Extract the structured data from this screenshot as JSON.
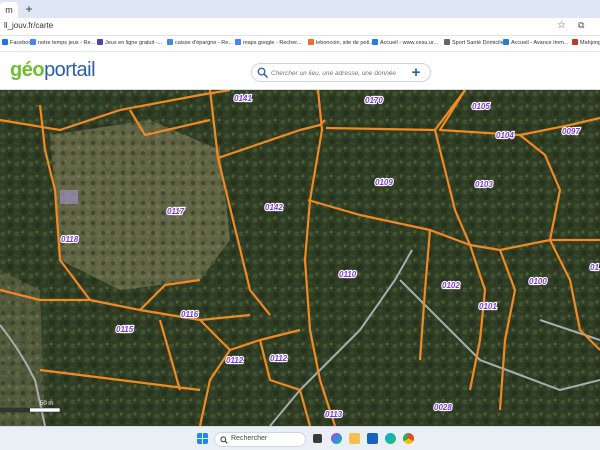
{
  "browser": {
    "tab_glyph": "m",
    "new_tab": "+",
    "url": "ll_jouv.fr/carte",
    "star_glyph": "☆",
    "ext_glyph": "⧉",
    "bookmarks": [
      {
        "label": "Facebook",
        "color": "#1877f2"
      },
      {
        "label": "notre temps jeux - Re...",
        "color": "#4285f4"
      },
      {
        "label": "Jeux en ligne gratuit -...",
        "color": "#5b3fa8"
      },
      {
        "label": "caisse d'épargne - Re...",
        "color": "#4285f4"
      },
      {
        "label": "maps google - Recher...",
        "color": "#4285f4"
      },
      {
        "label": "leboncoin, site de peti...",
        "color": "#f56b2a"
      },
      {
        "label": "Accueil - www.cesu.ur...",
        "color": "#2a7bd6"
      },
      {
        "label": "Sport Santé Domicile",
        "color": "#666666"
      },
      {
        "label": "Accueil - Avance Imm...",
        "color": "#2a7bd6"
      },
      {
        "label": "Mahjong",
        "color": "#c0392b"
      }
    ]
  },
  "header": {
    "logo_geo": "géo",
    "logo_portail": "portail",
    "search_placeholder": "Chercher un lieu, une adresse, une donnée",
    "plus_label": "+"
  },
  "map": {
    "parcel_color": "#f08a24",
    "road_color": "#a8aeb0",
    "label_color": "#7a3bd6",
    "parcels": [
      "0141",
      "0170",
      "0105",
      "0104",
      "0097",
      "0109",
      "0103",
      "0117",
      "0142",
      "0118",
      "0110",
      "0102",
      "0100",
      "0101",
      "0115",
      "0116",
      "0112",
      "0112",
      "0113",
      "0028",
      "01"
    ],
    "scale_label": "50 m"
  },
  "taskbar": {
    "search_label": "Rechercher",
    "icons": [
      "windows-icon",
      "task-view-icon",
      "copilot-icon",
      "explorer-icon",
      "store-icon",
      "edge-icon",
      "chrome-icon"
    ]
  }
}
